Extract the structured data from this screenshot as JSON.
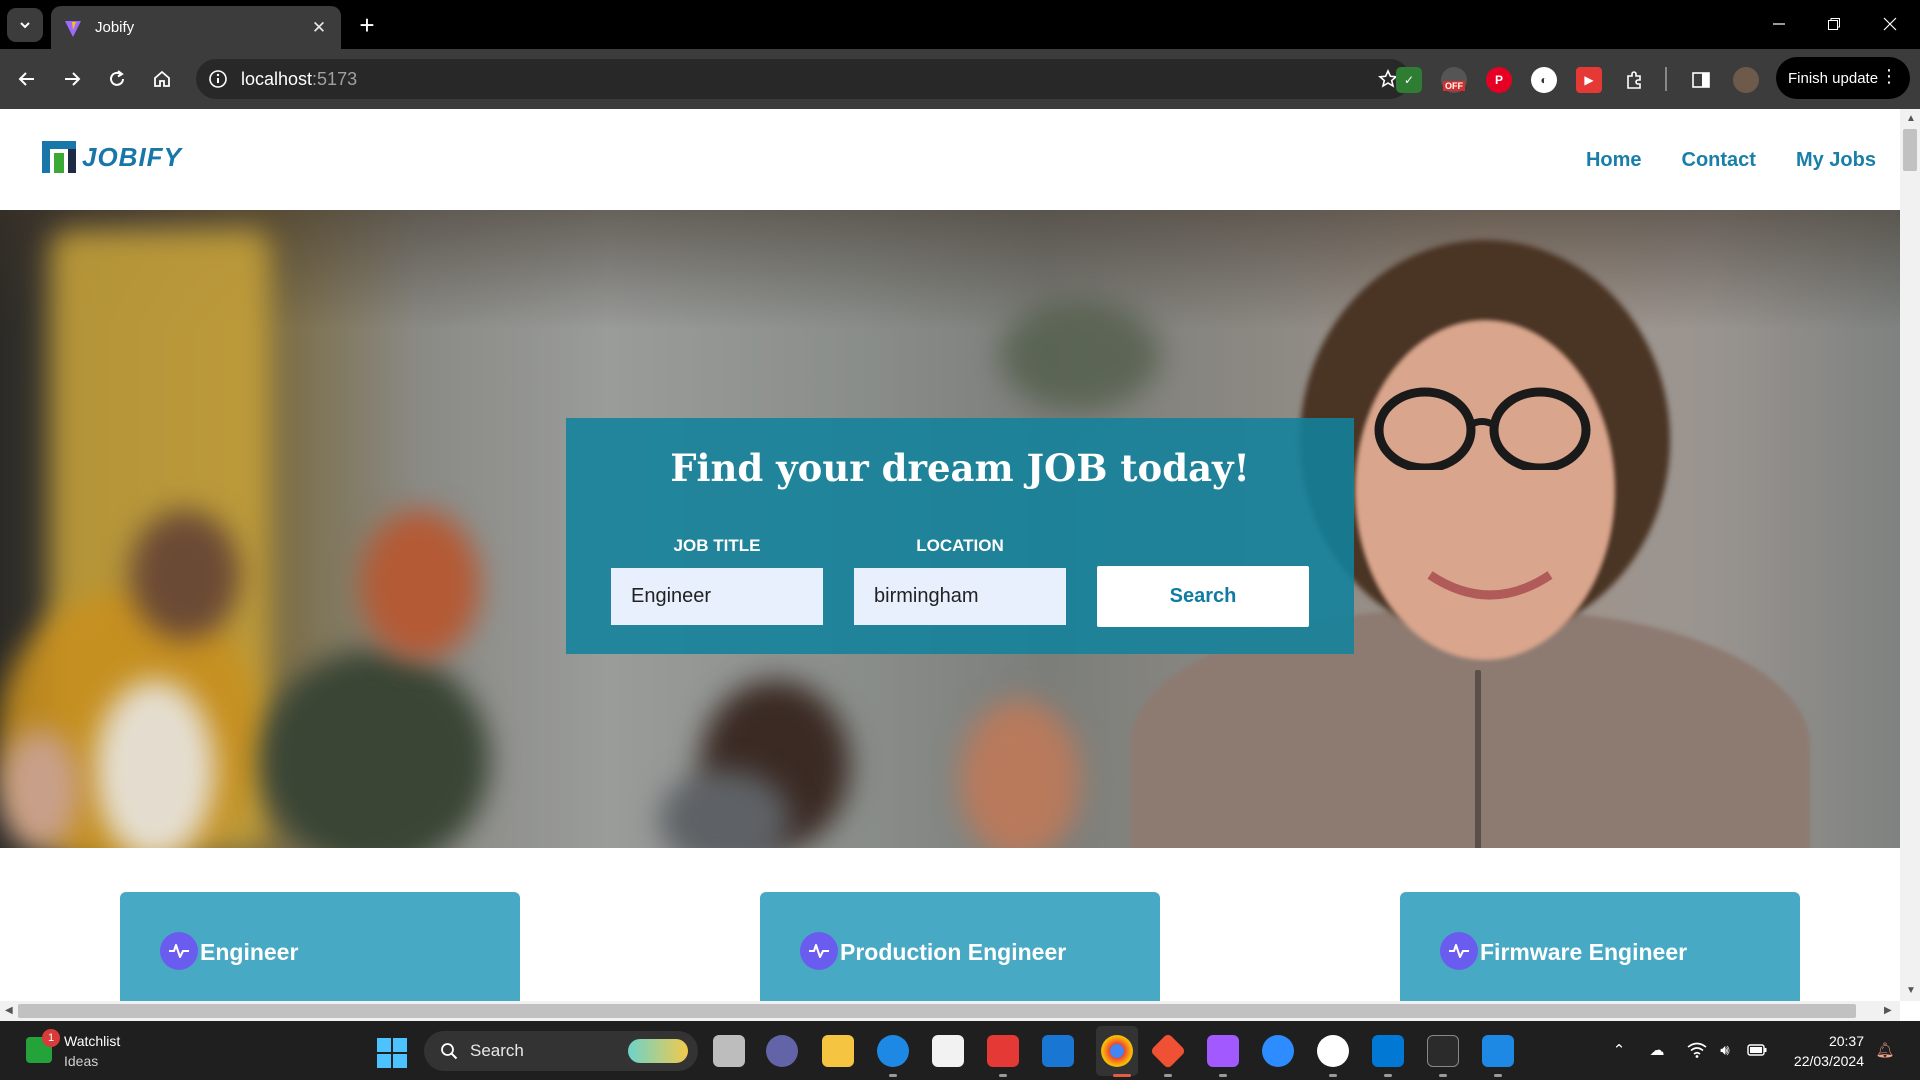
{
  "browser": {
    "tab_title": "Jobify",
    "url_host": "localhost",
    "url_port": ":5173",
    "finish_update_label": "Finish update",
    "extension_badge": "OFF"
  },
  "site": {
    "logo_text": "JOBIFY",
    "nav": [
      "Home",
      "Contact",
      "My Jobs"
    ]
  },
  "search": {
    "heading": "Find your dream JOB today!",
    "job_title_label": "JOB TITLE",
    "location_label": "LOCATION",
    "job_title_value": "Engineer",
    "location_value": "birmingham",
    "button_label": "Search"
  },
  "job_cards": [
    {
      "title": "Engineer",
      "icon": "activity-icon"
    },
    {
      "title": "Production Engineer",
      "icon": "activity-icon"
    },
    {
      "title": "Firmware Engineer",
      "icon": "activity-icon"
    }
  ],
  "taskbar": {
    "widget_title": "Watchlist",
    "widget_subtitle": "Ideas",
    "widget_badge": "1",
    "search_placeholder": "Search",
    "time": "20:37",
    "date": "22/03/2024"
  },
  "colors": {
    "brand": "#1a7fa8",
    "card": "#48a9c5",
    "search_panel": "#11829c",
    "icon_badge": "#6b5cf0"
  }
}
